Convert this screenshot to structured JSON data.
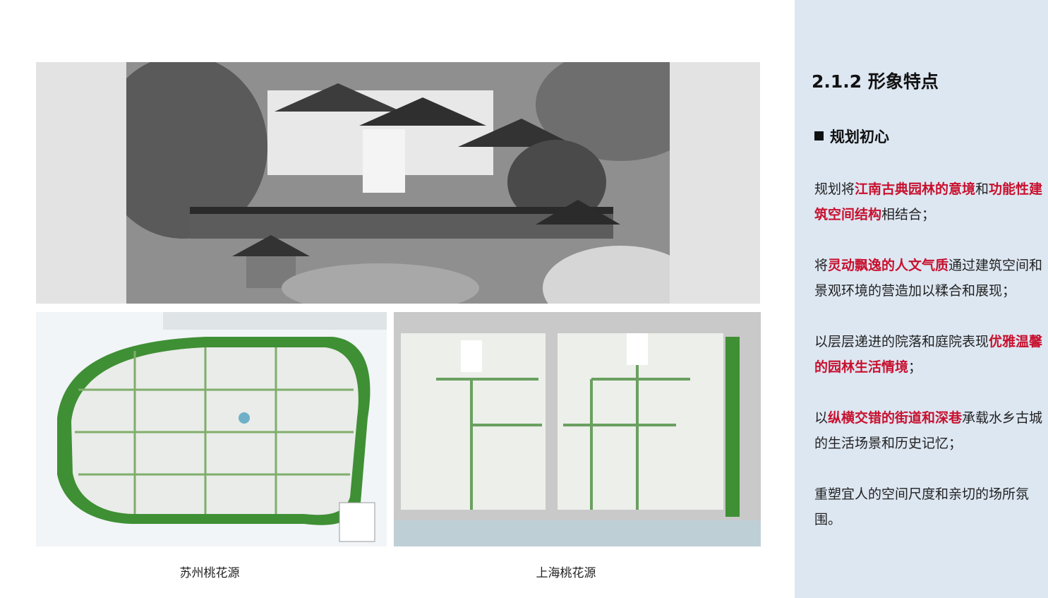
{
  "captions": {
    "left": "苏州桃花源",
    "right": "上海桃花源"
  },
  "sidebar": {
    "section_title": "2.1.2  形象特点",
    "sub_title": "规划初心",
    "p1": {
      "a": "规划将",
      "b": "江南古典园林的意境",
      "c": "和",
      "d": "功能性建筑空间结构",
      "e": "相结合；"
    },
    "p2": {
      "a": "将",
      "b": "灵动飘逸的人文气质",
      "c": "通过建筑空间和景观环境的营造加以糅合和展现；"
    },
    "p3": {
      "a": "以层层递进的院落和庭院表现",
      "b": "优雅温馨的园林生活情境",
      "c": "；"
    },
    "p4": {
      "a": "以",
      "b": "纵横交错的街道和深巷",
      "c": "承载水乡古城的生活场景和历史记忆；"
    },
    "p5": {
      "a": "重塑宜人的空间尺度和亲切的场所氛围。"
    }
  },
  "colors": {
    "highlight": "#c8102e",
    "sidebar_bg": "#dde7f2",
    "greenery": "#3f8f35"
  }
}
